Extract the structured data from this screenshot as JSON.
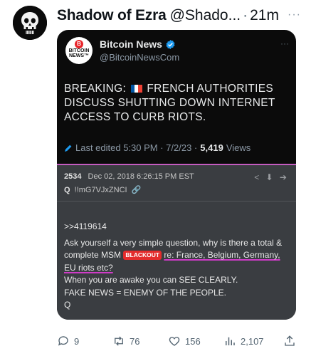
{
  "post": {
    "author_name": "Shadow of Ezra",
    "author_handle": "@Shado...",
    "separator": "·",
    "time": "21m",
    "more": "···"
  },
  "quoted": {
    "logo_line1": "BITCOIN",
    "logo_line2": "NEWS™",
    "logo_badge": "B",
    "name": "Bitcoin News",
    "handle": "@BitcoinNewsCom",
    "more": "···",
    "text_part1": "BREAKING:",
    "text_part2": "FRENCH AUTHORITIES DISCUSS SHUTTING DOWN INTERNET ACCESS TO CURB RIOTS.",
    "edited": "Last edited 5:30 PM · 7/2/23 ·",
    "views_count": "5,419",
    "views_label": "Views"
  },
  "board": {
    "post_number": "2534",
    "post_date": "Dec 02, 2018 6:26:15 PM EST",
    "trip_name": "Q",
    "tripcode": "!!mG7VJxZNCI",
    "link_icon": "🔗",
    "icons": "< ⬇ ➔",
    "line1": ">>4119614",
    "line2": "Ask yourself a very simple question, why is there a  total &",
    "line3a": "complete MSM",
    "blackout": "BLACKOUT",
    "line3b": "re: France, Belgium, Germany,",
    "line4": "EU riots etc?",
    "line5": "When you are awake you can SEE CLEARLY.",
    "line6": "FAKE NEWS = ENEMY OF THE PEOPLE.",
    "line7": "Q"
  },
  "actions": {
    "replies": "9",
    "reposts": "76",
    "likes": "156",
    "views": "2,107"
  },
  "colors": {
    "card_bg": "#0b0b0b",
    "board_bg": "#3a3d41",
    "divider": "#c45bc0",
    "blackout": "#e32c2c",
    "verified": "#1d9bf0"
  }
}
